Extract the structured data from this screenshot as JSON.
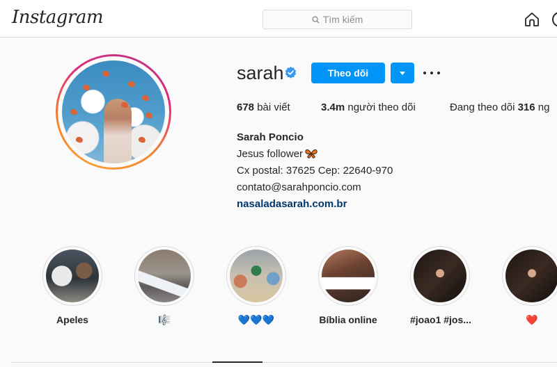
{
  "header": {
    "logo": "Instagram",
    "search_placeholder": "Tìm kiếm",
    "icons": [
      "search-icon",
      "home-icon",
      "direct-icon"
    ]
  },
  "profile": {
    "username": "sarah",
    "verified": true,
    "follow_label": "Theo dõi",
    "stats": {
      "posts_count": "678",
      "posts_label": " bài viết",
      "followers_count": "3.4m",
      "followers_label": " người theo dõi",
      "following_prefix": "Đang theo dõi ",
      "following_count": "316",
      "following_suffix": " ng"
    },
    "bio": {
      "full_name": "Sarah Poncio",
      "line1": "Jesus follower",
      "line1_emoji": "butterfly",
      "line2": "Cx postal: 37625 Cep: 22640-970",
      "line3": "contato@sarahponcio.com",
      "website": "nasaladasarah.com.br"
    }
  },
  "highlights": [
    {
      "label": "Apeles"
    },
    {
      "label": "🎼"
    },
    {
      "label": "💙💙💙"
    },
    {
      "label": "Bíblia online"
    },
    {
      "label": "#joao1 #jos..."
    },
    {
      "label": "❤️"
    }
  ],
  "colors": {
    "accent": "#0095f6",
    "link": "#00376b",
    "border": "#dbdbdb",
    "background": "#fafafa"
  }
}
